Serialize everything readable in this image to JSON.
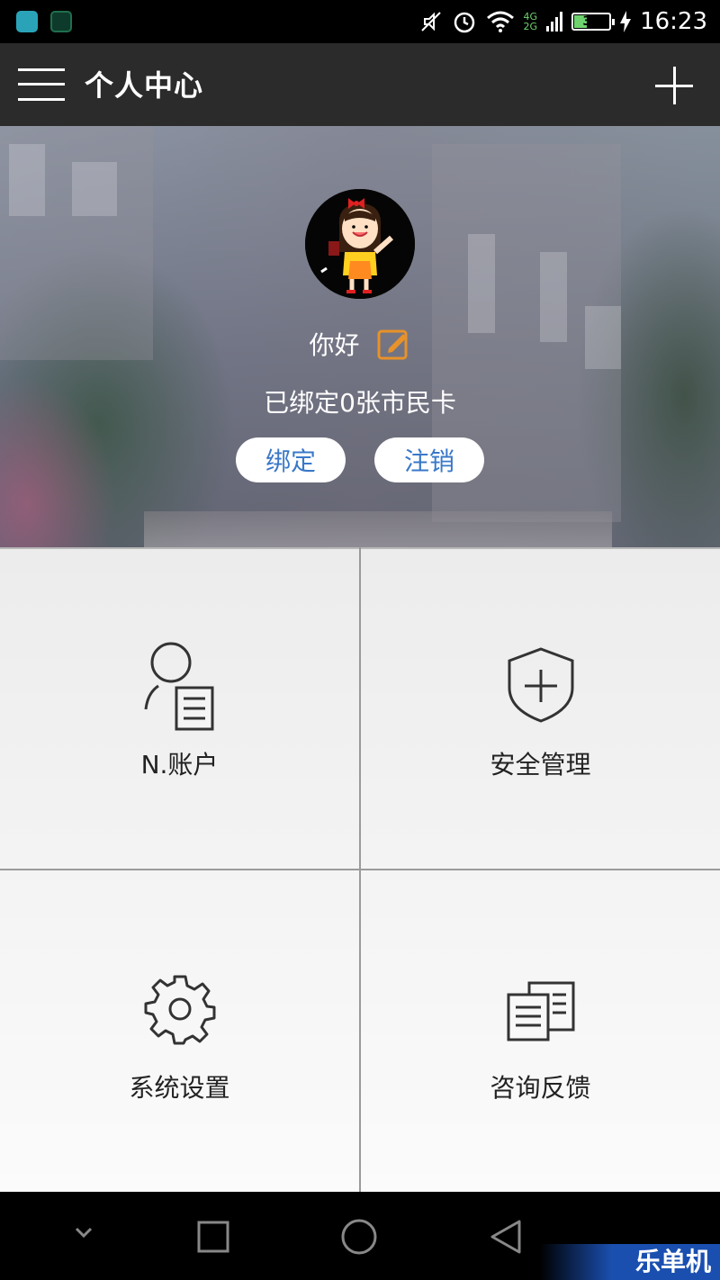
{
  "status_bar": {
    "network_4g": "4G",
    "network_2g": "2G",
    "battery": "34",
    "time": "16:23"
  },
  "app_bar": {
    "title": "个人中心"
  },
  "profile": {
    "name": "你好",
    "card_info": "已绑定0张市民卡",
    "bind_label": "绑定",
    "cancel_label": "注销"
  },
  "grid": {
    "account_label": "N.账户",
    "security_label": "安全管理",
    "settings_label": "系统设置",
    "feedback_label": "咨询反馈"
  },
  "watermark": "乐单机",
  "colors": {
    "app_bar_bg": "#2b2b2b",
    "accent_blue": "#3a78c8",
    "edit_orange": "#e8922a"
  }
}
